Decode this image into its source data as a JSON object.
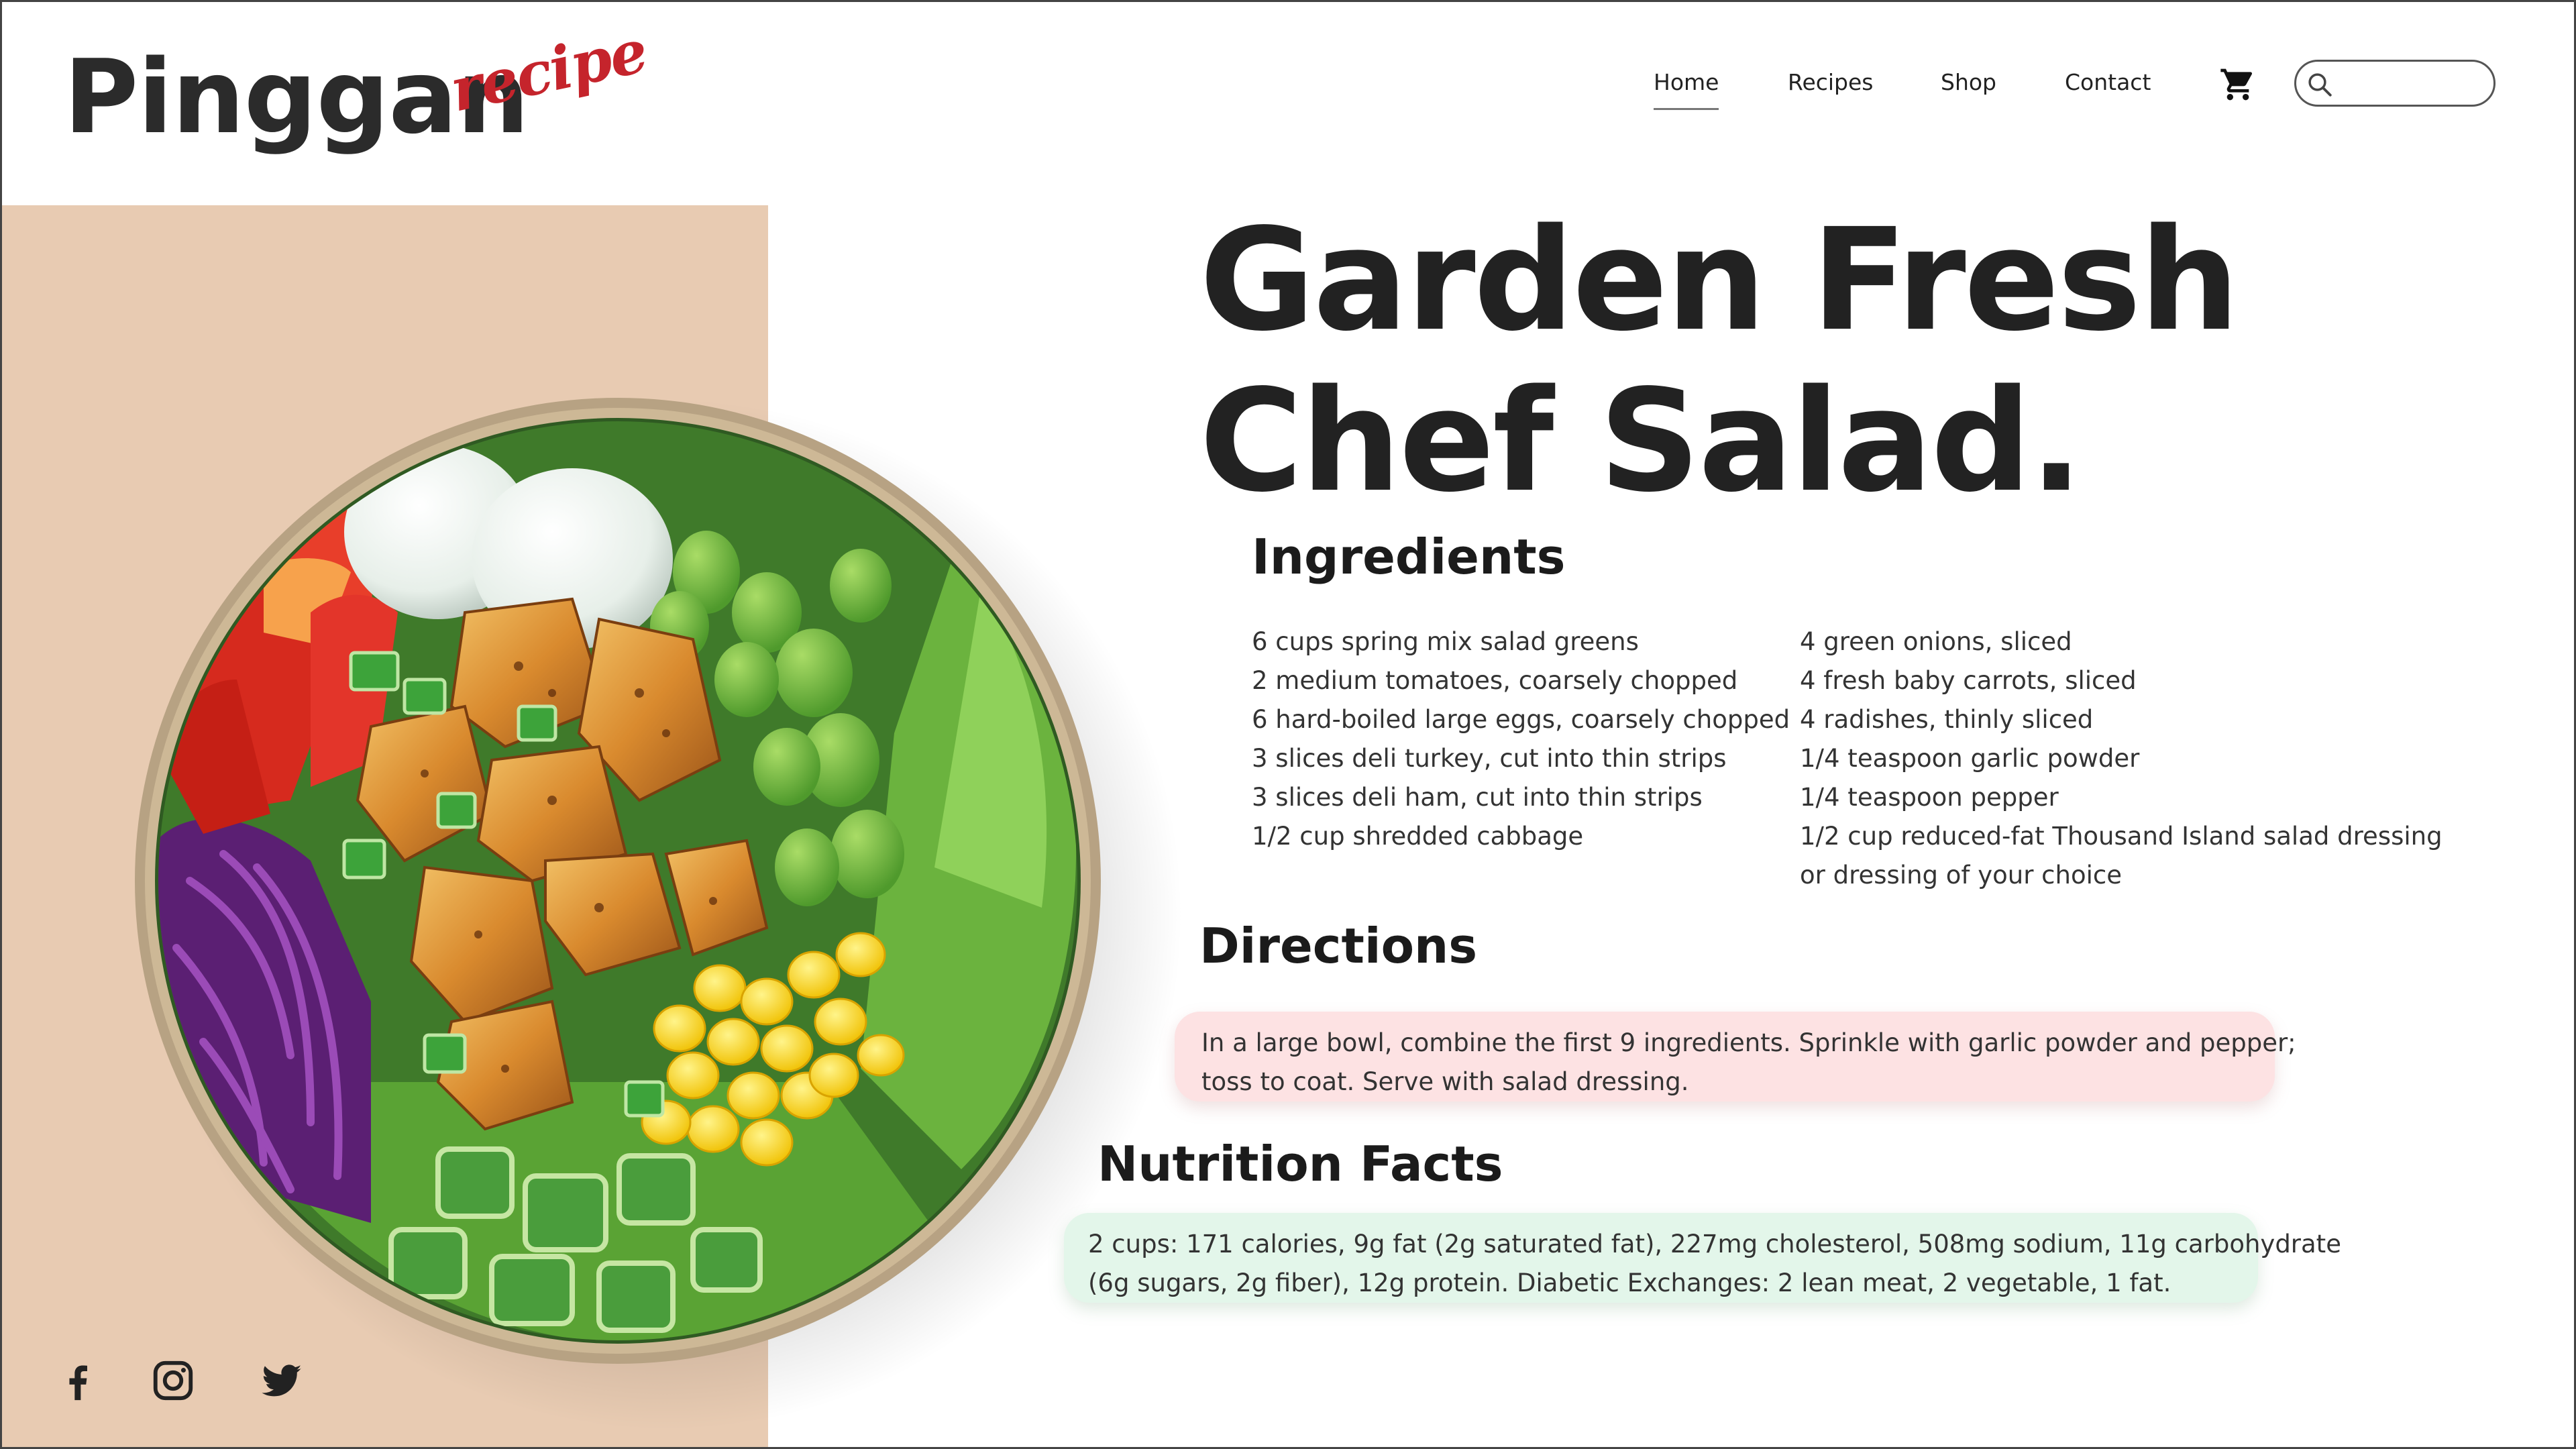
{
  "brand": {
    "name": "Pinggan",
    "tagline": "recipe",
    "accent_color": "#c5242c"
  },
  "nav": {
    "items": [
      {
        "label": "Home",
        "active": true
      },
      {
        "label": "Recipes",
        "active": false
      },
      {
        "label": "Shop",
        "active": false
      },
      {
        "label": "Contact",
        "active": false
      }
    ],
    "cart_icon": "shopping-cart-icon",
    "search": {
      "icon": "search-icon",
      "placeholder": "",
      "value": ""
    }
  },
  "hero": {
    "background_color": "#e8cbb2",
    "image_subject": "salad bowl with eggs, tomatoes, red cabbage, tofu, corn, edamame, lettuce and cucumber"
  },
  "recipe": {
    "title_line1": "Garden Fresh",
    "title_line2": "Chef Salad.",
    "ingredients_heading": "Ingredients",
    "ingredients_left": [
      "6 cups spring mix salad greens",
      "2 medium tomatoes, coarsely chopped",
      "6 hard-boiled large eggs, coarsely chopped",
      "3 slices deli turkey, cut into thin strips",
      "3 slices deli ham, cut into thin strips",
      "1/2 cup shredded cabbage"
    ],
    "ingredients_right": [
      "4 green onions, sliced",
      "4 fresh baby carrots, sliced",
      "4 radishes, thinly sliced",
      "1/4 teaspoon garlic powder",
      "1/4 teaspoon pepper",
      "1/2 cup reduced-fat Thousand Island salad dressing",
      "or dressing of your choice"
    ],
    "directions_heading": "Directions",
    "directions_line1": "In a large bowl, combine the first 9 ingredients. Sprinkle with garlic powder and pepper;",
    "directions_line2": "toss to coat. Serve with salad dressing.",
    "directions_color": "#fde2e3",
    "nutrition_heading": "Nutrition Facts",
    "nutrition_line1": "2 cups: 171 calories, 9g fat (2g saturated fat), 227mg cholesterol, 508mg sodium, 11g carbohydrate",
    "nutrition_line2": "(6g sugars, 2g fiber), 12g protein. Diabetic Exchanges: 2 lean meat, 2 vegetable, 1 fat.",
    "nutrition_color": "#e3f6ea"
  },
  "social": [
    {
      "icon": "facebook-icon"
    },
    {
      "icon": "instagram-icon"
    },
    {
      "icon": "twitter-icon"
    }
  ]
}
